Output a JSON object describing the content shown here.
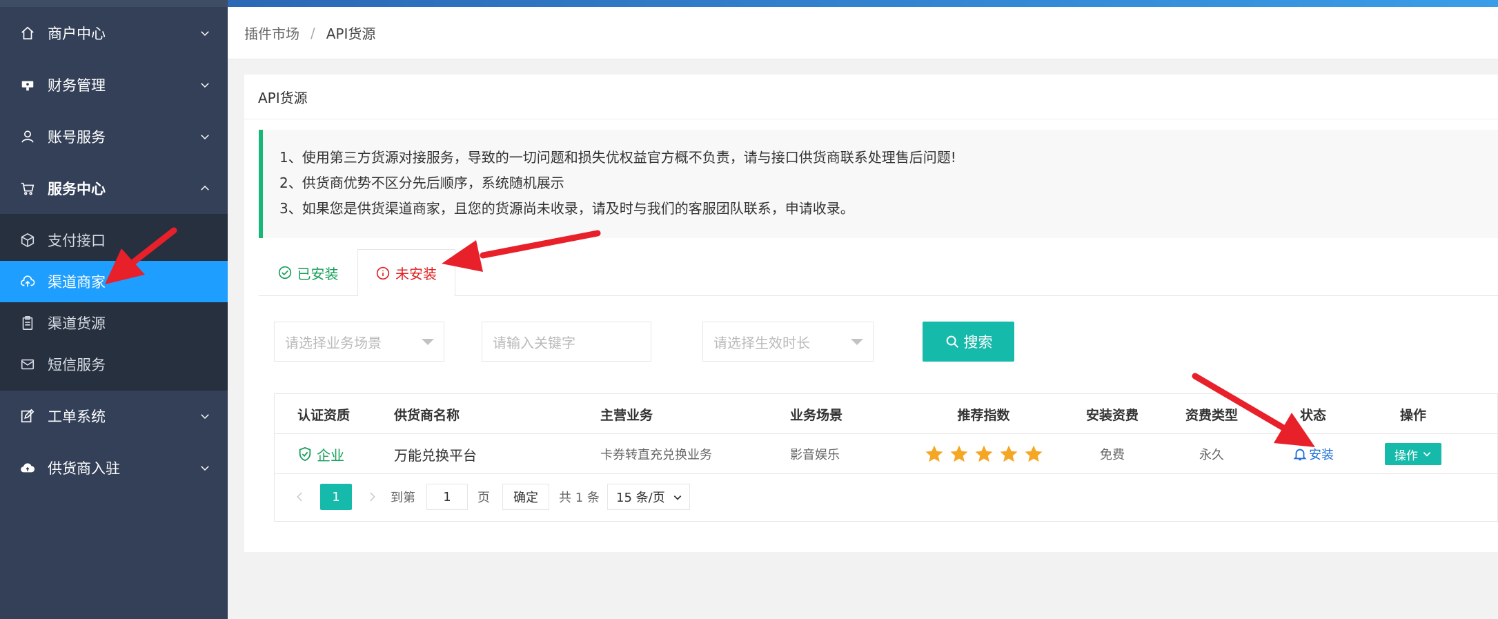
{
  "sidebar": {
    "items": [
      {
        "label": "商户中心",
        "icon": "home-icon"
      },
      {
        "label": "财务管理",
        "icon": "finance-icon"
      },
      {
        "label": "账号服务",
        "icon": "user-icon"
      },
      {
        "label": "服务中心",
        "icon": "cart-icon"
      }
    ],
    "submenu": [
      {
        "label": "支付接口",
        "icon": "cube-icon"
      },
      {
        "label": "渠道商家",
        "icon": "cloud-upload-icon"
      },
      {
        "label": "渠道货源",
        "icon": "clipboard-icon"
      },
      {
        "label": "短信服务",
        "icon": "mail-icon"
      }
    ],
    "items_bottom": [
      {
        "label": "工单系统",
        "icon": "edit-icon"
      },
      {
        "label": "供货商入驻",
        "icon": "cloud-icon"
      }
    ]
  },
  "breadcrumb": {
    "parent": "插件市场",
    "separator": "/",
    "current": "API货源"
  },
  "card": {
    "title": "API货源",
    "notice": [
      "1、使用第三方货源对接服务，导致的一切问题和损失优权益官方概不负责，请与接口供货商联系处理售后问题!",
      "2、供货商优势不区分先后顺序，系统随机展示",
      "3、如果您是供货渠道商家，且您的货源尚未收录，请及时与我们的客服团队联系，申请收录。"
    ]
  },
  "tabs": {
    "installed": "已安装",
    "uninstalled": "未安装"
  },
  "filters": {
    "scene_placeholder": "请选择业务场景",
    "keyword_placeholder": "请输入关键字",
    "duration_placeholder": "请选择生效时长",
    "search_label": "搜索"
  },
  "table": {
    "headers": [
      "认证资质",
      "供货商名称",
      "主营业务",
      "业务场景",
      "推荐指数",
      "安装资费",
      "资费类型",
      "状态",
      "操作"
    ],
    "rows": [
      {
        "cert": "企业",
        "name": "万能兑换平台",
        "business": "卡券转直充兑换业务",
        "scene": "影音娱乐",
        "rating": 5,
        "fee": "免费",
        "fee_type": "永久",
        "status": "安装",
        "action": "操作"
      }
    ]
  },
  "pagination": {
    "current_page": "1",
    "goto_label": "到第",
    "goto_value": "1",
    "page_label": "页",
    "confirm_label": "确定",
    "total_label": "共 1 条",
    "page_size": "15 条/页"
  },
  "colors": {
    "sidebar_bg": "#334058",
    "active_item": "#1e9fff",
    "primary_teal": "#16baaa",
    "success_green": "#16a05a",
    "danger_red": "#e02020",
    "star": "#f5a623",
    "arrow_red": "#e8202a"
  }
}
